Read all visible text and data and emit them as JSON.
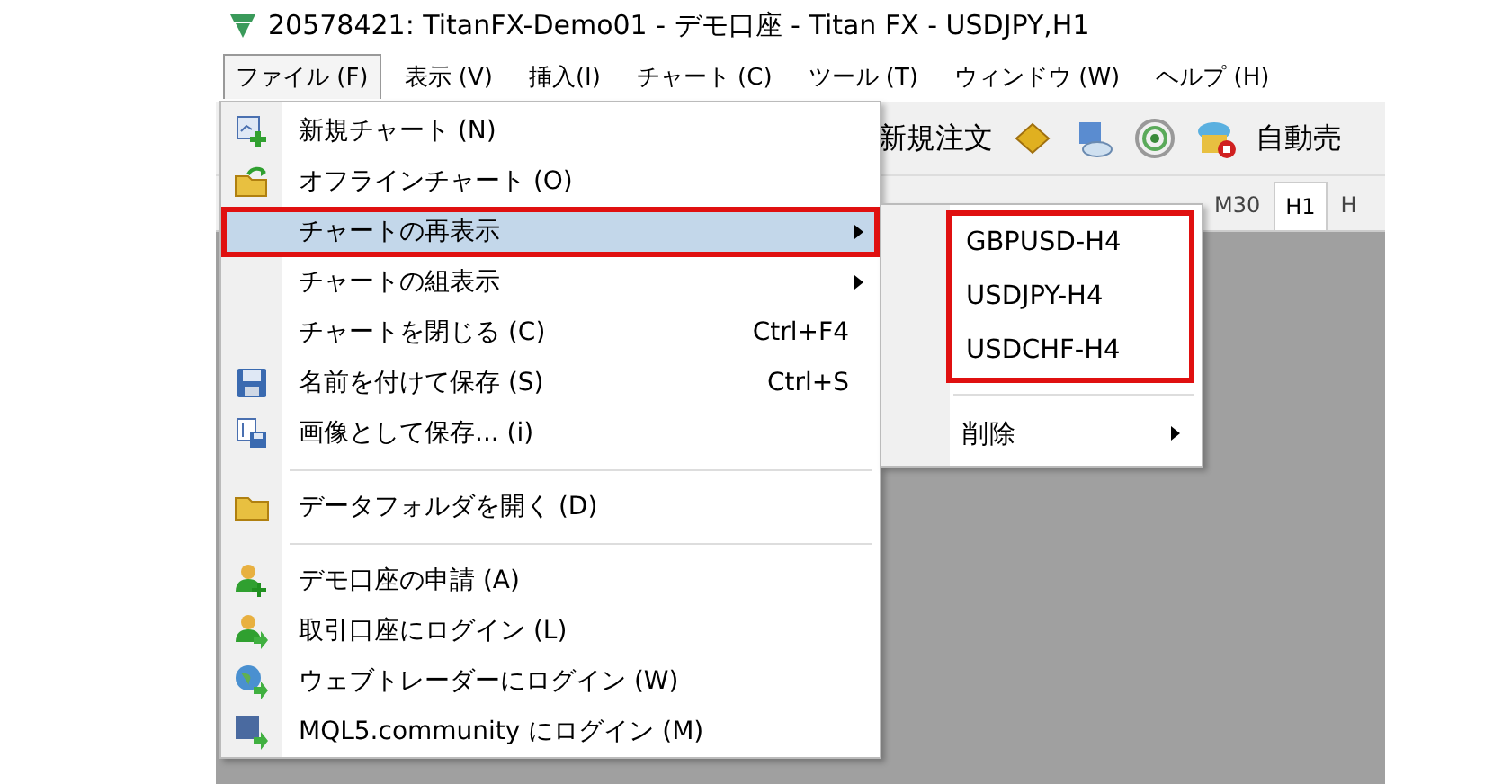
{
  "window": {
    "title": "20578421: TitanFX-Demo01 - デモ口座 - Titan FX - USDJPY,H1"
  },
  "menubar": [
    {
      "label": "ファイル (F)",
      "selected": true
    },
    {
      "label": "表示 (V)",
      "selected": false
    },
    {
      "label": "挿入(I)",
      "selected": false
    },
    {
      "label": "チャート (C)",
      "selected": false
    },
    {
      "label": "ツール (T)",
      "selected": false
    },
    {
      "label": "ウィンドウ (W)",
      "selected": false
    },
    {
      "label": "ヘルプ (H)",
      "selected": false
    }
  ],
  "toolbar": {
    "new_order": "新規注文",
    "auto_trade": "自動売"
  },
  "timeframes": [
    {
      "label": "M30",
      "selected": false
    },
    {
      "label": "H1",
      "selected": true
    },
    {
      "label": "H",
      "selected": false
    }
  ],
  "file_menu": [
    {
      "kind": "item",
      "label": "新規チャート (N)",
      "highlighted": false,
      "outlined": false
    },
    {
      "kind": "item",
      "label": "オフラインチャート (O)",
      "highlighted": false,
      "outlined": false
    },
    {
      "kind": "submenu",
      "label": "チャートの再表示",
      "highlighted": true,
      "outlined": true
    },
    {
      "kind": "submenu",
      "label": "チャートの組表示",
      "highlighted": false,
      "outlined": false
    },
    {
      "kind": "item",
      "label": "チャートを閉じる (C)",
      "shortcut": "Ctrl+F4",
      "highlighted": false,
      "outlined": false
    },
    {
      "kind": "item",
      "label": "名前を付けて保存 (S)",
      "shortcut": "Ctrl+S",
      "highlighted": false,
      "outlined": false
    },
    {
      "kind": "item",
      "label": "画像として保存... (i)",
      "highlighted": false,
      "outlined": false
    },
    {
      "kind": "separator"
    },
    {
      "kind": "item",
      "label": "データフォルダを開く (D)",
      "highlighted": false,
      "outlined": false
    },
    {
      "kind": "separator"
    },
    {
      "kind": "item",
      "label": "デモ口座の申請 (A)",
      "highlighted": false,
      "outlined": false
    },
    {
      "kind": "item",
      "label": "取引口座にログイン (L)",
      "highlighted": false,
      "outlined": false
    },
    {
      "kind": "item",
      "label": "ウェブトレーダーにログイン (W)",
      "highlighted": false,
      "outlined": false
    },
    {
      "kind": "item",
      "label": "MQL5.community にログイン (M)",
      "highlighted": false,
      "outlined": false
    }
  ],
  "recent_submenu": {
    "outlined": true,
    "charts": [
      "GBPUSD-H4",
      "USDJPY-H4",
      "USDCHF-H4"
    ],
    "delete": {
      "label": "削除"
    }
  }
}
